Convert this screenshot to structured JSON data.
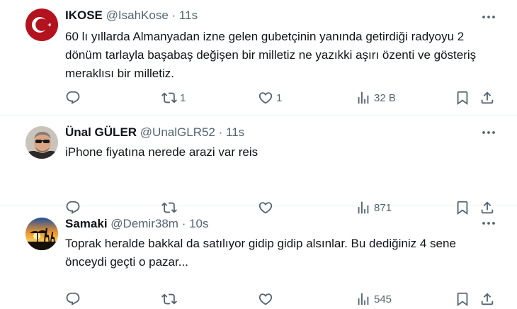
{
  "tweets": [
    {
      "name": "IKOSE",
      "handle": "@IsahKose",
      "dot": "·",
      "time": "11s",
      "text": "60 lı yıllarda Almanyadan izne gelen gubetçinin yanında getirdiği radyoyu 2 dönüm tarlayla başabaş değişen bir milletiz ne yazıkki aşırı özenti ve gösteriş meraklısı bir milletiz.",
      "replies": "",
      "retweets": "1",
      "likes": "1",
      "views": "32 B",
      "avatar": "turkish-flag-avatar"
    },
    {
      "name": "Ünal GÜLER",
      "handle": "@UnalGLR52",
      "dot": "·",
      "time": "11s",
      "text": "iPhone fiyatına nerede arazi var reis",
      "replies": "",
      "retweets": "",
      "likes": "",
      "views": "871",
      "avatar": "man-sunglasses-avatar"
    },
    {
      "name": "Samaki",
      "handle": "@Demir38m",
      "dot": "·",
      "time": "10s",
      "text": "Toprak heralde bakkal da satılıyor gidip gidip alsınlar. Bu dediğiniz 4 sene önceydi geçti o pazar...",
      "replies": "",
      "retweets": "",
      "likes": "",
      "views": "545",
      "avatar": "sunset-giraffes-avatar"
    }
  ],
  "colors": {
    "text": "#0f1419",
    "secondary": "#536471",
    "divider": "#eff3f4",
    "flag_red": "#c8102e"
  }
}
